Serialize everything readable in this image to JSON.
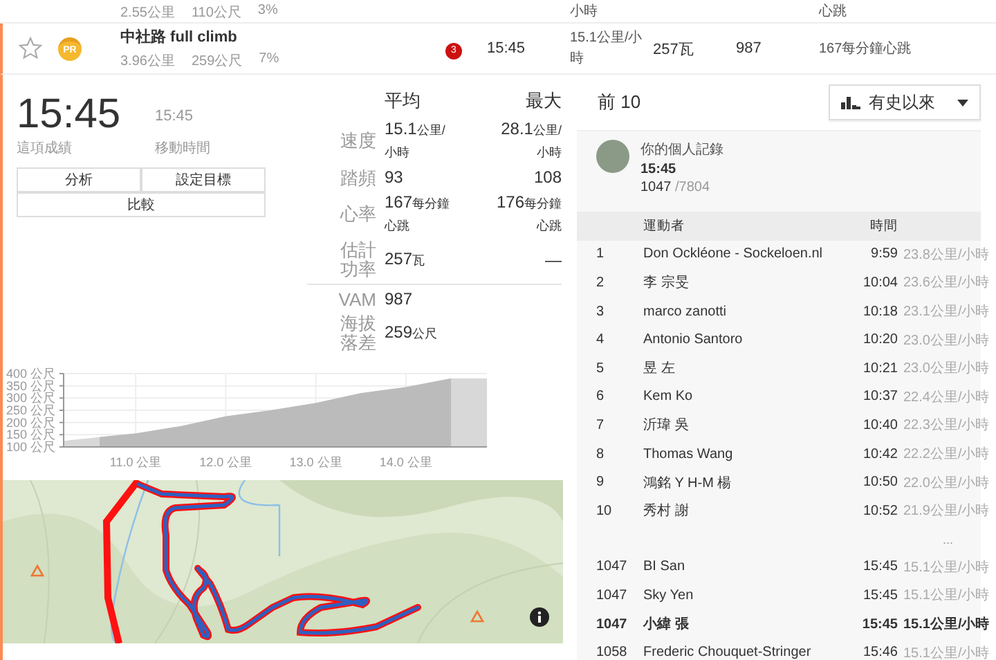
{
  "segments": [
    {
      "kind": "partial",
      "stats": [
        "2.55公里",
        "110公尺",
        "3%"
      ],
      "speed": "小時",
      "heart_rate": "心跳"
    },
    {
      "kind": "full",
      "starred": false,
      "medal": "PR",
      "name": "中社路 full climb",
      "stats": [
        "3.96公里",
        "259公尺",
        "7%"
      ],
      "rank_badge": "3",
      "time": "15:45",
      "speed": "15.1公里/小時",
      "power": "257瓦",
      "vam": "987",
      "heart_rate": "167每分鐘心跳"
    }
  ],
  "effort": {
    "time": "15:45",
    "time_label": "這項成績",
    "moving_time": "15:45",
    "moving_label": "移動時間",
    "button_rows": [
      [
        "分析",
        "設定目標"
      ],
      [
        "比較"
      ]
    ]
  },
  "stats": {
    "headers": [
      "平均",
      "最大"
    ],
    "rows": [
      {
        "label": "速度",
        "avg": {
          "value": "15.1",
          "unit": "公里/小時"
        },
        "max": {
          "value": "28.1",
          "unit": "公里/小時"
        }
      },
      {
        "label": "踏頻",
        "avg": {
          "value": "93"
        },
        "max": {
          "value": "108"
        }
      },
      {
        "label": "心率",
        "avg": {
          "value": "167",
          "unit": "每分鐘心跳"
        },
        "max": {
          "value": "176",
          "unit": "每分鐘心跳"
        }
      },
      {
        "label": "估計功率",
        "avg": {
          "value": "257",
          "unit": "瓦"
        },
        "max": {
          "value": "—"
        }
      }
    ],
    "extra": [
      {
        "label": "VAM",
        "value": "987"
      },
      {
        "label": "海拔落差",
        "value": "259",
        "unit": "公尺"
      }
    ]
  },
  "elevation": {
    "chart_data": {
      "type": "area",
      "x": [
        10.2,
        10.6,
        11.0,
        11.5,
        12.0,
        12.5,
        13.0,
        13.5,
        14.0,
        14.5,
        14.9
      ],
      "grid": true,
      "series": [
        {
          "color": "#bbbbbb",
          "values": [
            125,
            140,
            155,
            185,
            225,
            250,
            280,
            320,
            345,
            380,
            380
          ]
        }
      ],
      "xlim": [
        10.2,
        14.9
      ],
      "ylim": [
        100,
        400
      ],
      "xticks": [
        {
          "value": 11,
          "label": "11.0 公里"
        },
        {
          "value": 12,
          "label": "12.0 公里"
        },
        {
          "value": 13,
          "label": "13.0 公里"
        },
        {
          "value": 14,
          "label": "14.0 公里"
        }
      ],
      "yticks": [
        {
          "value": 100,
          "label": "100 公尺"
        },
        {
          "value": 150,
          "label": "150 公尺"
        },
        {
          "value": 200,
          "label": "200 公尺"
        },
        {
          "value": 250,
          "label": "250 公尺"
        },
        {
          "value": 300,
          "label": "300 公尺"
        },
        {
          "value": 350,
          "label": "350 公尺"
        },
        {
          "value": 400,
          "label": "400 公尺"
        }
      ]
    }
  },
  "leaderboard": {
    "title": "前 10",
    "filter": "有史以來",
    "personal_record": {
      "label": "你的個人記錄",
      "time": "15:45",
      "rank": "1047",
      "total": "/7804"
    },
    "columns": [
      "運動者",
      "時間"
    ],
    "rows": [
      {
        "rank": "1",
        "name": "Don Ockléone - Sockeloen.nl",
        "time": "9:59",
        "speed": "23.8公里/小時",
        "is_you": false
      },
      {
        "rank": "2",
        "name": "李 宗旻",
        "time": "10:04",
        "speed": "23.6公里/小時",
        "is_you": false
      },
      {
        "rank": "3",
        "name": "marco zanotti",
        "time": "10:18",
        "speed": "23.1公里/小時",
        "is_you": false
      },
      {
        "rank": "4",
        "name": "Antonio Santoro",
        "time": "10:20",
        "speed": "23.0公里/小時",
        "is_you": false
      },
      {
        "rank": "5",
        "name": "昱 左",
        "time": "10:21",
        "speed": "23.0公里/小時",
        "is_you": false
      },
      {
        "rank": "6",
        "name": "Kem Ko",
        "time": "10:37",
        "speed": "22.4公里/小時",
        "is_you": false
      },
      {
        "rank": "7",
        "name": "沂瑋 吳",
        "time": "10:40",
        "speed": "22.3公里/小時",
        "is_you": false
      },
      {
        "rank": "8",
        "name": "Thomas Wang",
        "time": "10:42",
        "speed": "22.2公里/小時",
        "is_you": false
      },
      {
        "rank": "9",
        "name": "鴻銘 Y H-M 楊",
        "time": "10:50",
        "speed": "22.0公里/小時",
        "is_you": false
      },
      {
        "rank": "10",
        "name": "秀村 謝",
        "time": "10:52",
        "speed": "21.9公里/小時",
        "is_you": false
      }
    ],
    "gap": "...",
    "nearby": [
      {
        "rank": "1047",
        "name": "BI San",
        "time": "15:45",
        "speed": "15.1公里/小時",
        "is_you": false
      },
      {
        "rank": "1047",
        "name": "Sky Yen",
        "time": "15:45",
        "speed": "15.1公里/小時",
        "is_you": false
      },
      {
        "rank": "1047",
        "name": "小緯 張",
        "time": "15:45",
        "speed": "15.1公里/小時",
        "is_you": true
      },
      {
        "rank": "1058",
        "name": "Frederic Chouquet-Stringer",
        "time": "15:46",
        "speed": "15.1公里/小時",
        "is_you": false
      }
    ]
  }
}
